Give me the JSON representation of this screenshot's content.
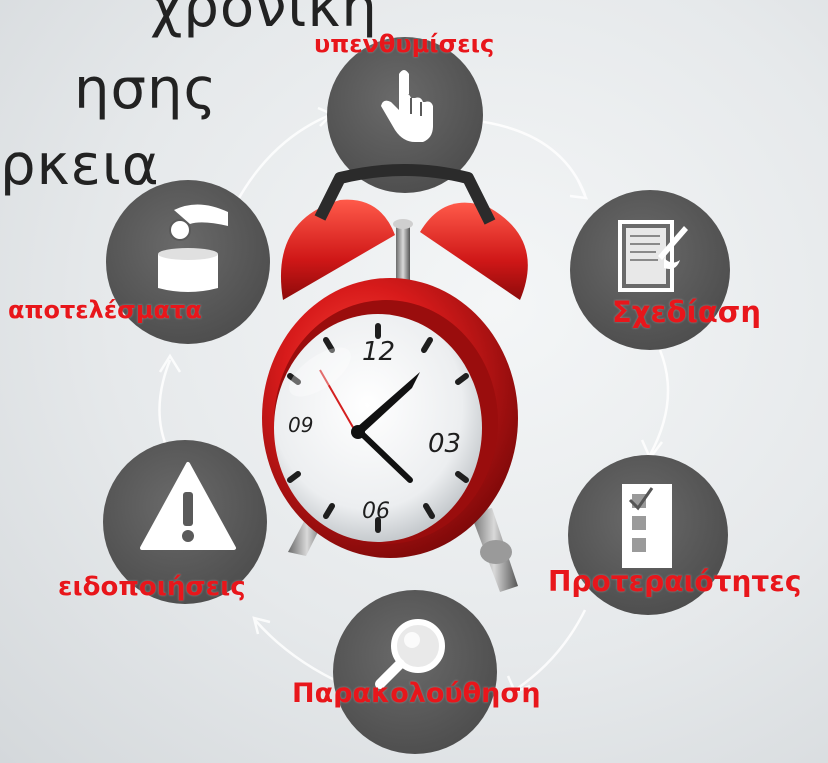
{
  "heading": {
    "line1": "χρονική",
    "line2": "ησης",
    "line3": "ρκεια"
  },
  "cycle": {
    "steps": [
      {
        "label": "υπενθυμίσεις",
        "icon": "pointing-hand-icon"
      },
      {
        "label": "Σχεδίαση",
        "icon": "document-pen-icon"
      },
      {
        "label": "Προτεραιότητες",
        "icon": "checklist-icon"
      },
      {
        "label": "Παρακολούθηση",
        "icon": "magnifier-icon"
      },
      {
        "label": "ειδοποιήσεις",
        "icon": "warning-triangle-icon"
      },
      {
        "label": "αποτελέσματα",
        "icon": "hand-coin-box-icon"
      }
    ],
    "label_color": "#e8161b",
    "circle_color": "#5a5a5a"
  },
  "clock": {
    "numbers": [
      "12",
      "03",
      "06",
      "09"
    ],
    "body_color": "#d41c1c",
    "icon": "alarm-clock-icon"
  }
}
